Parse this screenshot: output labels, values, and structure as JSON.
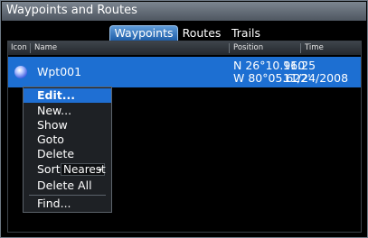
{
  "window": {
    "title": "Waypoints and Routes"
  },
  "tabs": [
    {
      "label": "Waypoints",
      "active": true
    },
    {
      "label": "Routes",
      "active": false
    },
    {
      "label": "Trails",
      "active": false
    }
  ],
  "table": {
    "columns": {
      "icon": "Icon",
      "name": "Name",
      "position": "Position",
      "time": "Time"
    },
    "rows": [
      {
        "icon": "waypoint-dot-icon",
        "name": "Wpt001",
        "lat": "N  26°10.960'",
        "lon": "W  80°05.622'",
        "time": "11:25",
        "date": "11/24/2008",
        "selected": true
      }
    ]
  },
  "context_menu": {
    "items": [
      {
        "label": "Edit...",
        "selected": true
      },
      {
        "label": "New..."
      },
      {
        "label": "Show"
      },
      {
        "label": "Goto"
      },
      {
        "label": "Delete"
      },
      {
        "label": "Sort",
        "value": "Nearest"
      },
      {
        "label": "Delete All"
      },
      {
        "label": "Find..."
      }
    ]
  },
  "colors": {
    "selection": "#1d6fd2",
    "titlebar": "#6f7883",
    "background": "#000000"
  }
}
